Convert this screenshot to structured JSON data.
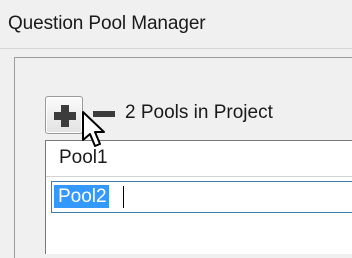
{
  "window": {
    "title": "Question Pool Manager"
  },
  "toolbar": {
    "add_icon": "plus-icon",
    "remove_icon": "minus-icon",
    "pool_count_text": "2 Pools in Project"
  },
  "pool_list": {
    "items": [
      {
        "label": "Pool1",
        "selected": false
      },
      {
        "label": "Pool2",
        "selected": true,
        "editing": true
      }
    ]
  },
  "colors": {
    "selection": "#3399ff",
    "icon": "#3c3c3c"
  }
}
